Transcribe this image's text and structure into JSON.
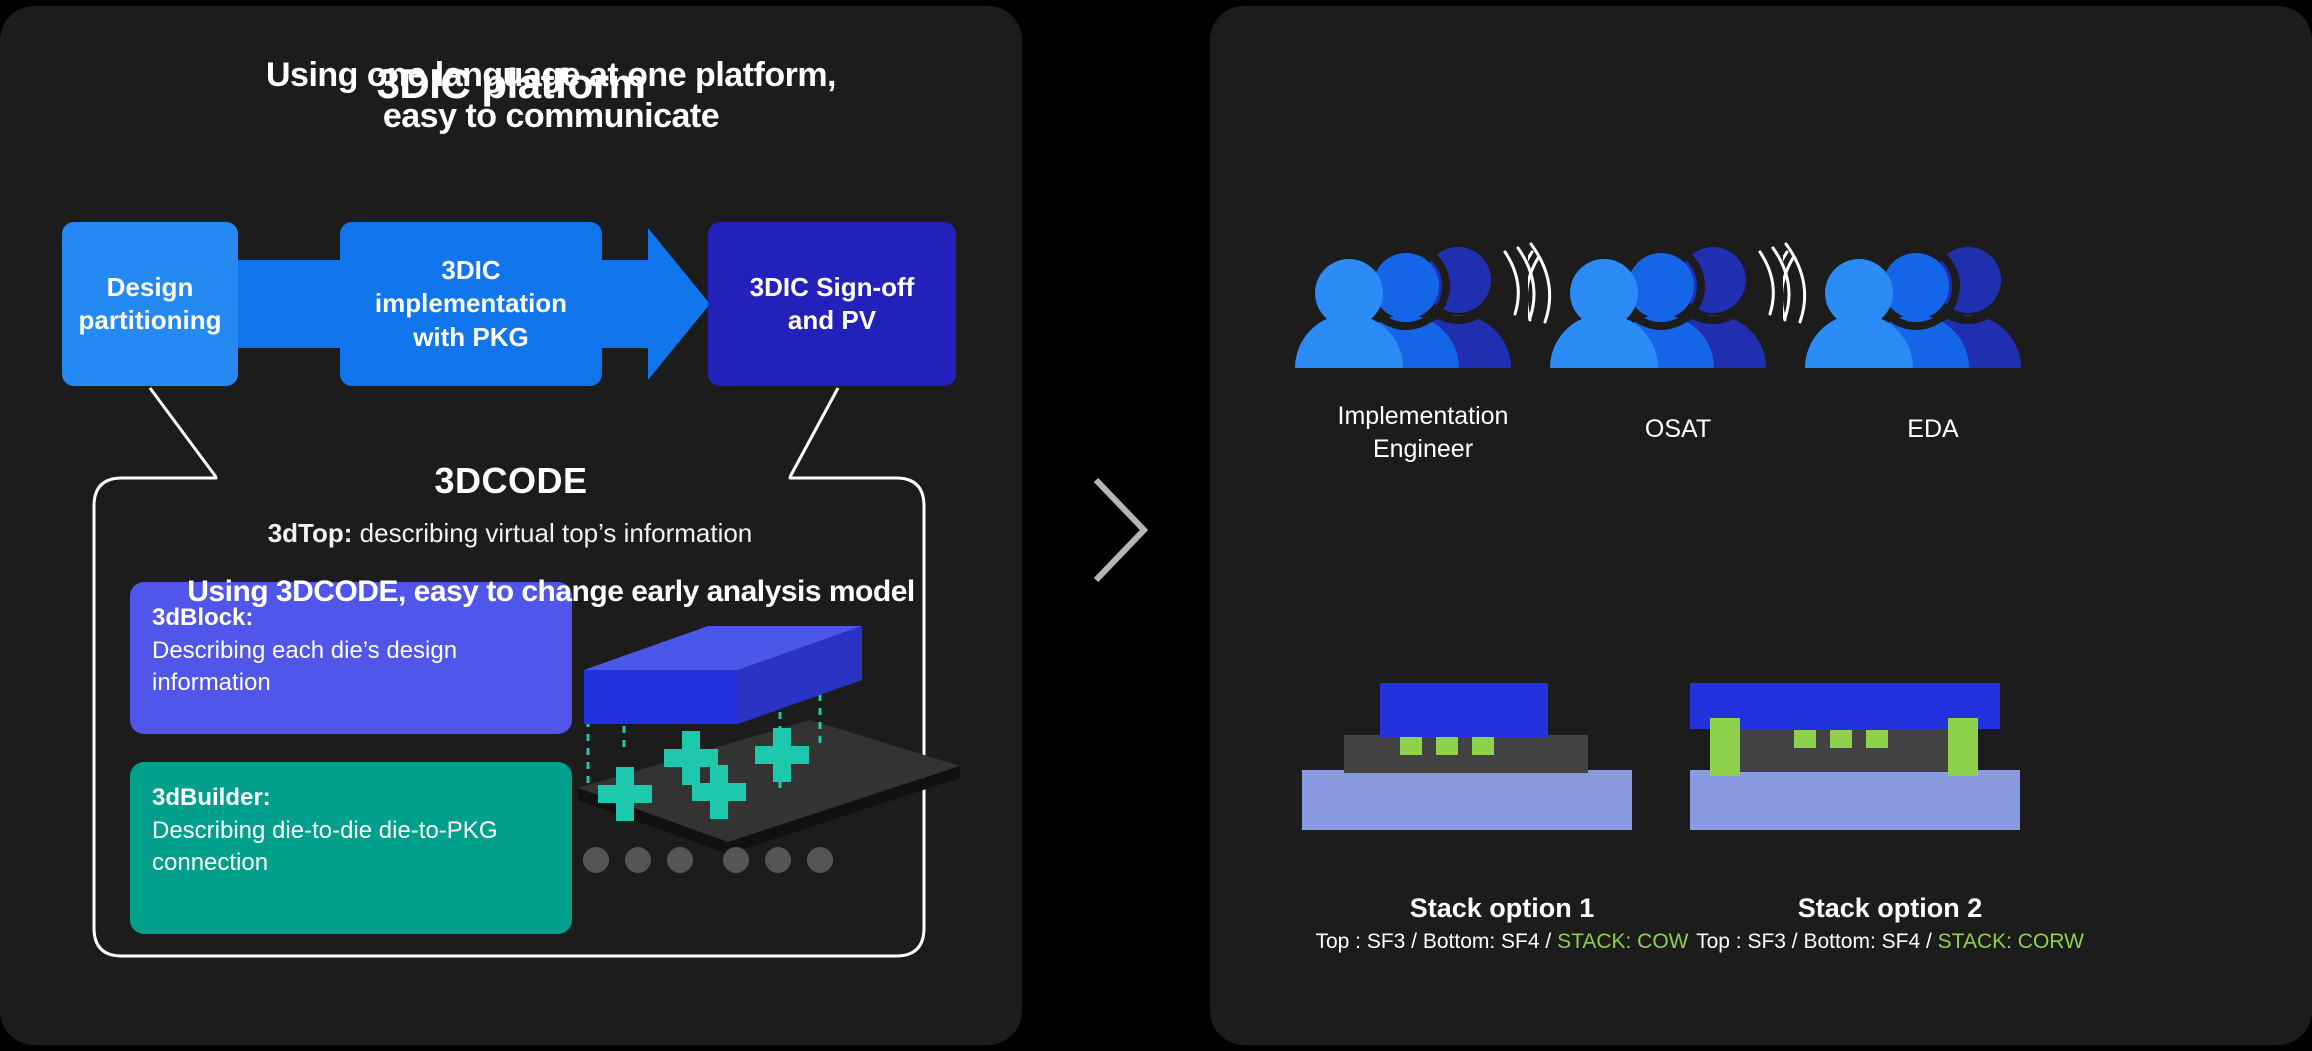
{
  "left_panel": {
    "title": "3DIC platform",
    "flow": [
      {
        "label": "Design\npartitioning",
        "color": "#2489f2"
      },
      {
        "label": "3DIC\nimplementation\nwith PKG",
        "color": "#1175ee"
      },
      {
        "label": "3DIC Sign-off\nand PV",
        "color": "#2222bb"
      }
    ],
    "code_section": {
      "title": "3DCODE",
      "subtitle_bold": "3dTop:",
      "subtitle_rest": " describing virtual top’s information",
      "cards": [
        {
          "name": "3dBlock:",
          "desc": "Describing each die’s design information",
          "color": "#5056ea"
        },
        {
          "name": "3dBuilder:",
          "desc": "Describing die-to-die die-to-PKG connection",
          "color": "#00a08c"
        }
      ]
    }
  },
  "right_panel": {
    "title_line1": "Using one language at one platform,",
    "title_line2": "easy to communicate",
    "people": [
      {
        "label_line1": "Implementation",
        "label_line2": "Engineer"
      },
      {
        "label_line1": "OSAT",
        "label_line2": ""
      },
      {
        "label_line1": "EDA",
        "label_line2": ""
      }
    ],
    "subtitle": "Using 3DCODE, easy to change early analysis model",
    "stacks": [
      {
        "name": "Stack option 1",
        "spec_plain": "Top : SF3 / Bottom: SF4 / ",
        "spec_highlight": "STACK: COW"
      },
      {
        "name": "Stack option 2",
        "spec_plain": "Top : SF3 / Bottom: SF4 / ",
        "spec_highlight": "STACK: CORW"
      }
    ]
  },
  "colors": {
    "page_background": "#000000",
    "panel_background": "#1c1c1c",
    "accent_light_blue": "#2489f2",
    "accent_blue": "#1175ee",
    "accent_deep_blue": "#2222bb",
    "accent_periwinkle": "#5056ea",
    "accent_teal": "#00a08c",
    "accent_green": "#8ed14a",
    "stack_bottom_die": "#8a9ae0",
    "stack_interposer": "#424242",
    "frame_stroke": "#ffffff",
    "chevron_stroke": "#b5b5b5"
  }
}
